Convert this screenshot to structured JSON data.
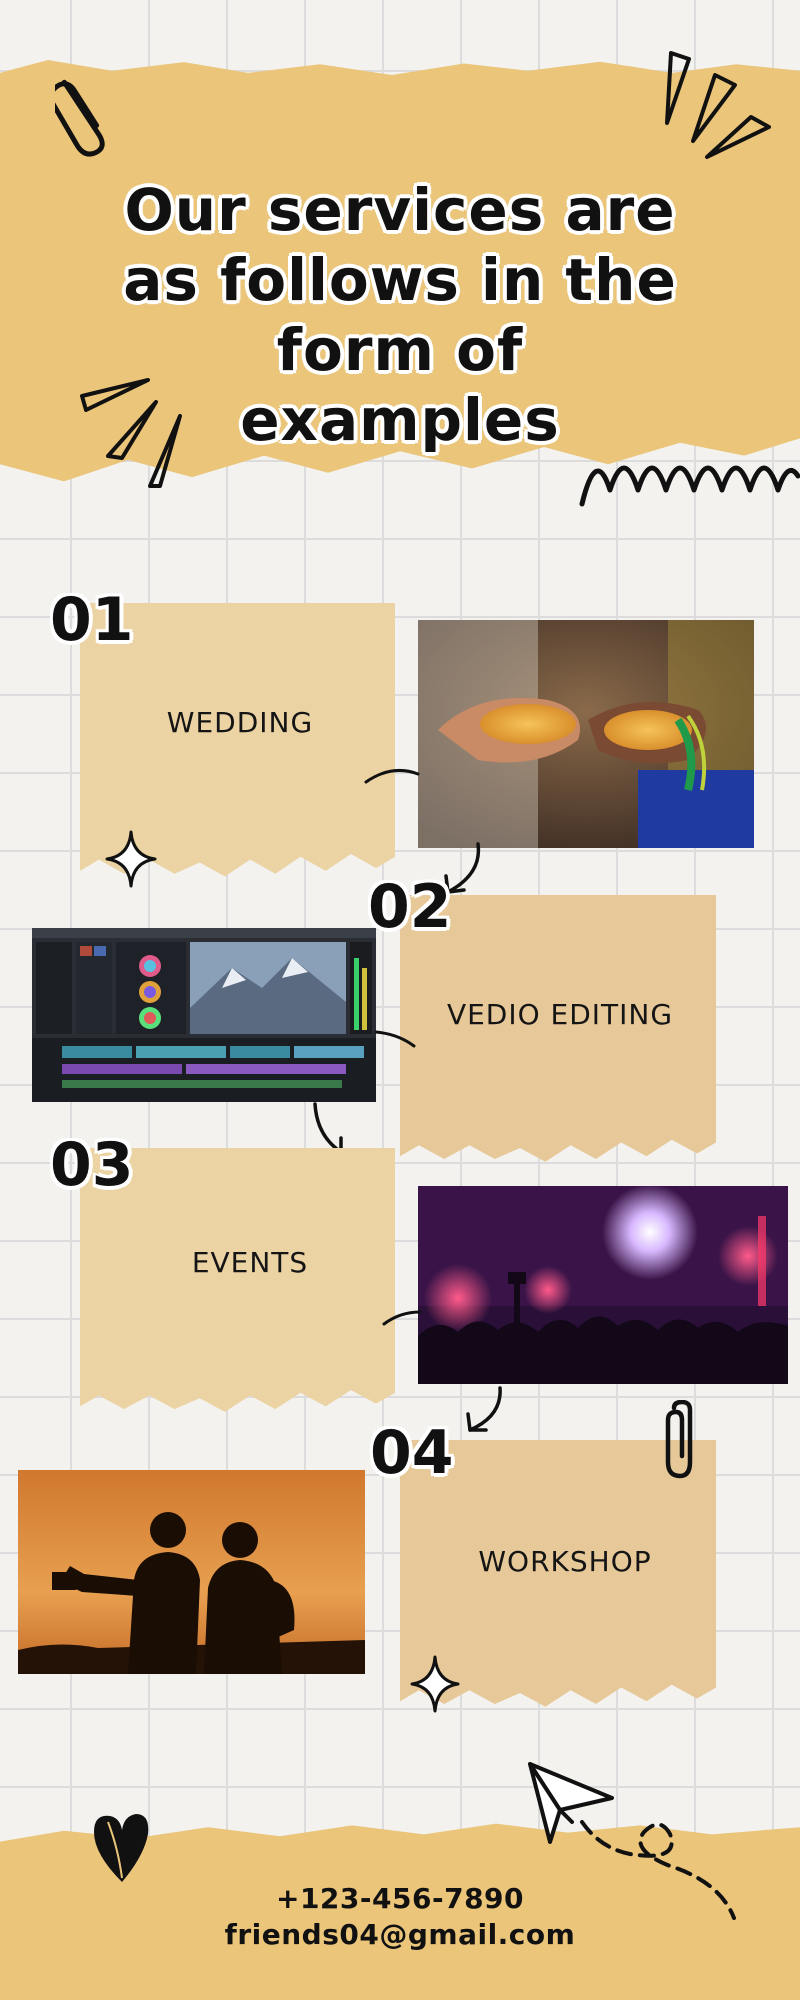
{
  "header": {
    "title_line1": "Our services are",
    "title_line2": "as follows in the",
    "title_line3": "form of examples"
  },
  "services": [
    {
      "number": "01",
      "label": "WEDDING"
    },
    {
      "number": "02",
      "label": "VEDIO EDITING"
    },
    {
      "number": "03",
      "label": "EVENTS"
    },
    {
      "number": "04",
      "label": "WORKSHOP"
    }
  ],
  "footer": {
    "phone": "+123-456-7890",
    "email": "friends04@gmail.com"
  },
  "colors": {
    "banner": "#eac57a",
    "paper": "#ebd3a4",
    "grid": "#dcdcdc",
    "ink": "#111111"
  },
  "icons": [
    "paperclip-icon",
    "burst-lines-icon",
    "zigzag-doodle-icon",
    "sparkle-icon",
    "curved-arrow-icon",
    "heart-icon",
    "paper-plane-icon"
  ]
}
